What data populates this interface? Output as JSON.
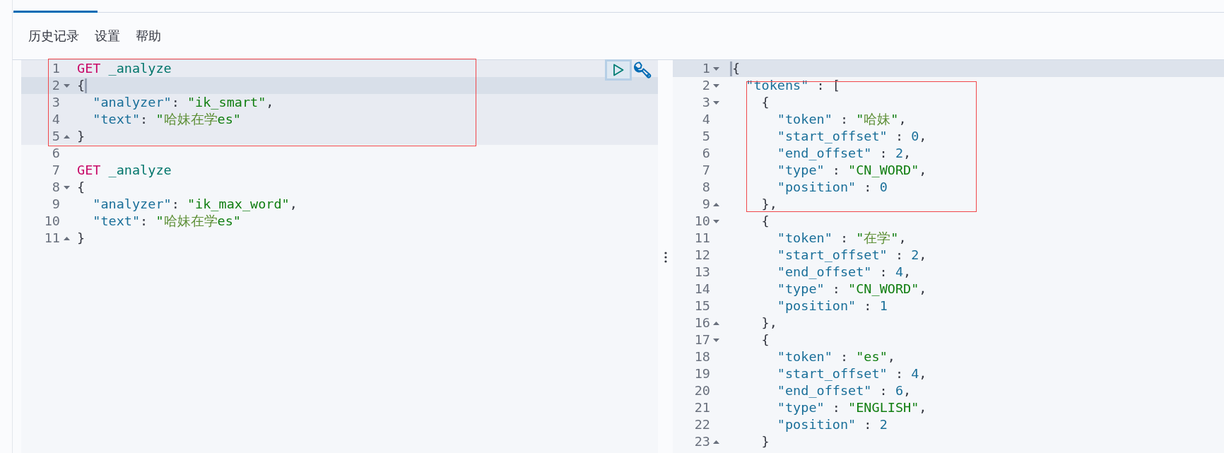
{
  "menu": [
    {
      "label": "历史记录"
    },
    {
      "label": "设置"
    },
    {
      "label": "帮助"
    }
  ],
  "request_editor": {
    "lines": [
      {
        "kind": "annotated_block",
        "lines": [
          {
            "number": "1",
            "in_selection": true,
            "cursor": false,
            "segments": [
              {
                "kind": "method",
                "text": "GET"
              },
              {
                "kind": "path",
                "text": " _analyze"
              }
            ]
          },
          {
            "number": "2",
            "in_selection": true,
            "cursor": true,
            "fold_start": true,
            "segments": [
              {
                "kind": "punct",
                "text": "{"
              }
            ]
          },
          {
            "number": "3",
            "in_selection": true,
            "cursor": false,
            "segments": [
              {
                "kind": "key",
                "text": "  \"analyzer\""
              },
              {
                "kind": "punct",
                "text": ": "
              },
              {
                "kind": "string",
                "text": "\"ik_smart\""
              },
              {
                "kind": "punct",
                "text": ","
              }
            ]
          },
          {
            "number": "4",
            "in_selection": true,
            "cursor": false,
            "segments": [
              {
                "kind": "key",
                "text": "  \"text\""
              },
              {
                "kind": "punct",
                "text": ": "
              },
              {
                "kind": "string",
                "text": "\""
              },
              {
                "kind": "cjk",
                "text": "哈妹在学"
              },
              {
                "kind": "string",
                "text": "es\""
              }
            ]
          },
          {
            "number": "5",
            "in_selection": true,
            "cursor": false,
            "fold_end": true,
            "segments": [
              {
                "kind": "punct",
                "text": "}"
              }
            ]
          }
        ]
      },
      {
        "kind": "line",
        "number": "6",
        "in_selection": false,
        "cursor": false
      },
      {
        "kind": "line",
        "number": "7",
        "in_selection": false,
        "cursor": false,
        "segments": [
          {
            "kind": "method",
            "text": "GET"
          },
          {
            "kind": "path",
            "text": " _analyze"
          }
        ]
      },
      {
        "kind": "line",
        "number": "8",
        "in_selection": false,
        "cursor": false,
        "fold_start": true,
        "segments": [
          {
            "kind": "punct",
            "text": "{"
          }
        ]
      },
      {
        "kind": "line",
        "number": "9",
        "in_selection": false,
        "cursor": false,
        "segments": [
          {
            "kind": "key",
            "text": "  \"analyzer\""
          },
          {
            "kind": "punct",
            "text": ": "
          },
          {
            "kind": "string",
            "text": "\"ik_max_word\""
          },
          {
            "kind": "punct",
            "text": ","
          }
        ]
      },
      {
        "kind": "line",
        "number": "10",
        "in_selection": false,
        "cursor": false,
        "segments": [
          {
            "kind": "key",
            "text": "  \"text\""
          },
          {
            "kind": "punct",
            "text": ": "
          },
          {
            "kind": "string",
            "text": "\""
          },
          {
            "kind": "cjk",
            "text": "哈妹在学"
          },
          {
            "kind": "string",
            "text": "es\""
          }
        ]
      },
      {
        "kind": "line",
        "number": "11",
        "in_selection": false,
        "cursor": false,
        "fold_end": true,
        "segments": [
          {
            "kind": "punct",
            "text": "}"
          }
        ]
      }
    ]
  },
  "response_viewer": {
    "lines": [
      {
        "kind": "line",
        "number": "1",
        "cursor": true,
        "fold_start": true,
        "segments": [
          {
            "kind": "punct",
            "text": "{"
          }
        ]
      },
      {
        "kind": "annotated_block",
        "lines": [
          {
            "number": "2",
            "cursor": false,
            "fold_start": true,
            "segments": [
              {
                "kind": "key",
                "text": "  \"tokens\""
              },
              {
                "kind": "punct",
                "text": " : ["
              }
            ]
          },
          {
            "number": "3",
            "cursor": false,
            "fold_start": true,
            "segments": [
              {
                "kind": "punct",
                "text": "    {"
              }
            ]
          },
          {
            "number": "4",
            "cursor": false,
            "segments": [
              {
                "kind": "key",
                "text": "      \"token\""
              },
              {
                "kind": "punct",
                "text": " : "
              },
              {
                "kind": "string",
                "text": "\""
              },
              {
                "kind": "cjk",
                "text": "哈妹"
              },
              {
                "kind": "string",
                "text": "\""
              },
              {
                "kind": "punct",
                "text": ","
              }
            ]
          },
          {
            "number": "5",
            "cursor": false,
            "segments": [
              {
                "kind": "key",
                "text": "      \"start_offset\""
              },
              {
                "kind": "punct",
                "text": " : "
              },
              {
                "kind": "number",
                "text": "0"
              },
              {
                "kind": "punct",
                "text": ","
              }
            ]
          },
          {
            "number": "6",
            "cursor": false,
            "segments": [
              {
                "kind": "key",
                "text": "      \"end_offset\""
              },
              {
                "kind": "punct",
                "text": " : "
              },
              {
                "kind": "number",
                "text": "2"
              },
              {
                "kind": "punct",
                "text": ","
              }
            ]
          },
          {
            "number": "7",
            "cursor": false,
            "segments": [
              {
                "kind": "key",
                "text": "      \"type\""
              },
              {
                "kind": "punct",
                "text": " : "
              },
              {
                "kind": "string",
                "text": "\"CN_WORD\""
              },
              {
                "kind": "punct",
                "text": ","
              }
            ]
          },
          {
            "number": "8",
            "cursor": false,
            "segments": [
              {
                "kind": "key",
                "text": "      \"position\""
              },
              {
                "kind": "punct",
                "text": " : "
              },
              {
                "kind": "number",
                "text": "0"
              }
            ]
          },
          {
            "number": "9",
            "cursor": false,
            "fold_end": true,
            "segments": [
              {
                "kind": "punct",
                "text": "    },"
              }
            ]
          }
        ]
      },
      {
        "kind": "line",
        "number": "10",
        "cursor": false,
        "fold_start": true,
        "segments": [
          {
            "kind": "punct",
            "text": "    {"
          }
        ]
      },
      {
        "kind": "line",
        "number": "11",
        "cursor": false,
        "segments": [
          {
            "kind": "key",
            "text": "      \"token\""
          },
          {
            "kind": "punct",
            "text": " : "
          },
          {
            "kind": "string",
            "text": "\""
          },
          {
            "kind": "cjk",
            "text": "在学"
          },
          {
            "kind": "string",
            "text": "\""
          },
          {
            "kind": "punct",
            "text": ","
          }
        ]
      },
      {
        "kind": "line",
        "number": "12",
        "cursor": false,
        "segments": [
          {
            "kind": "key",
            "text": "      \"start_offset\""
          },
          {
            "kind": "punct",
            "text": " : "
          },
          {
            "kind": "number",
            "text": "2"
          },
          {
            "kind": "punct",
            "text": ","
          }
        ]
      },
      {
        "kind": "line",
        "number": "13",
        "cursor": false,
        "segments": [
          {
            "kind": "key",
            "text": "      \"end_offset\""
          },
          {
            "kind": "punct",
            "text": " : "
          },
          {
            "kind": "number",
            "text": "4"
          },
          {
            "kind": "punct",
            "text": ","
          }
        ]
      },
      {
        "kind": "line",
        "number": "14",
        "cursor": false,
        "segments": [
          {
            "kind": "key",
            "text": "      \"type\""
          },
          {
            "kind": "punct",
            "text": " : "
          },
          {
            "kind": "string",
            "text": "\"CN_WORD\""
          },
          {
            "kind": "punct",
            "text": ","
          }
        ]
      },
      {
        "kind": "line",
        "number": "15",
        "cursor": false,
        "segments": [
          {
            "kind": "key",
            "text": "      \"position\""
          },
          {
            "kind": "punct",
            "text": " : "
          },
          {
            "kind": "number",
            "text": "1"
          }
        ]
      },
      {
        "kind": "line",
        "number": "16",
        "cursor": false,
        "fold_end": true,
        "segments": [
          {
            "kind": "punct",
            "text": "    },"
          }
        ]
      },
      {
        "kind": "line",
        "number": "17",
        "cursor": false,
        "fold_start": true,
        "segments": [
          {
            "kind": "punct",
            "text": "    {"
          }
        ]
      },
      {
        "kind": "line",
        "number": "18",
        "cursor": false,
        "segments": [
          {
            "kind": "key",
            "text": "      \"token\""
          },
          {
            "kind": "punct",
            "text": " : "
          },
          {
            "kind": "string",
            "text": "\"es\""
          },
          {
            "kind": "punct",
            "text": ","
          }
        ]
      },
      {
        "kind": "line",
        "number": "19",
        "cursor": false,
        "segments": [
          {
            "kind": "key",
            "text": "      \"start_offset\""
          },
          {
            "kind": "punct",
            "text": " : "
          },
          {
            "kind": "number",
            "text": "4"
          },
          {
            "kind": "punct",
            "text": ","
          }
        ]
      },
      {
        "kind": "line",
        "number": "20",
        "cursor": false,
        "segments": [
          {
            "kind": "key",
            "text": "      \"end_offset\""
          },
          {
            "kind": "punct",
            "text": " : "
          },
          {
            "kind": "number",
            "text": "6"
          },
          {
            "kind": "punct",
            "text": ","
          }
        ]
      },
      {
        "kind": "line",
        "number": "21",
        "cursor": false,
        "segments": [
          {
            "kind": "key",
            "text": "      \"type\""
          },
          {
            "kind": "punct",
            "text": " : "
          },
          {
            "kind": "string",
            "text": "\"ENGLISH\""
          },
          {
            "kind": "punct",
            "text": ","
          }
        ]
      },
      {
        "kind": "line",
        "number": "22",
        "cursor": false,
        "segments": [
          {
            "kind": "key",
            "text": "      \"position\""
          },
          {
            "kind": "punct",
            "text": " : "
          },
          {
            "kind": "number",
            "text": "2"
          }
        ]
      },
      {
        "kind": "line",
        "number": "23",
        "cursor": false,
        "fold_end": true,
        "segments": [
          {
            "kind": "punct",
            "text": "    }"
          }
        ]
      }
    ]
  }
}
